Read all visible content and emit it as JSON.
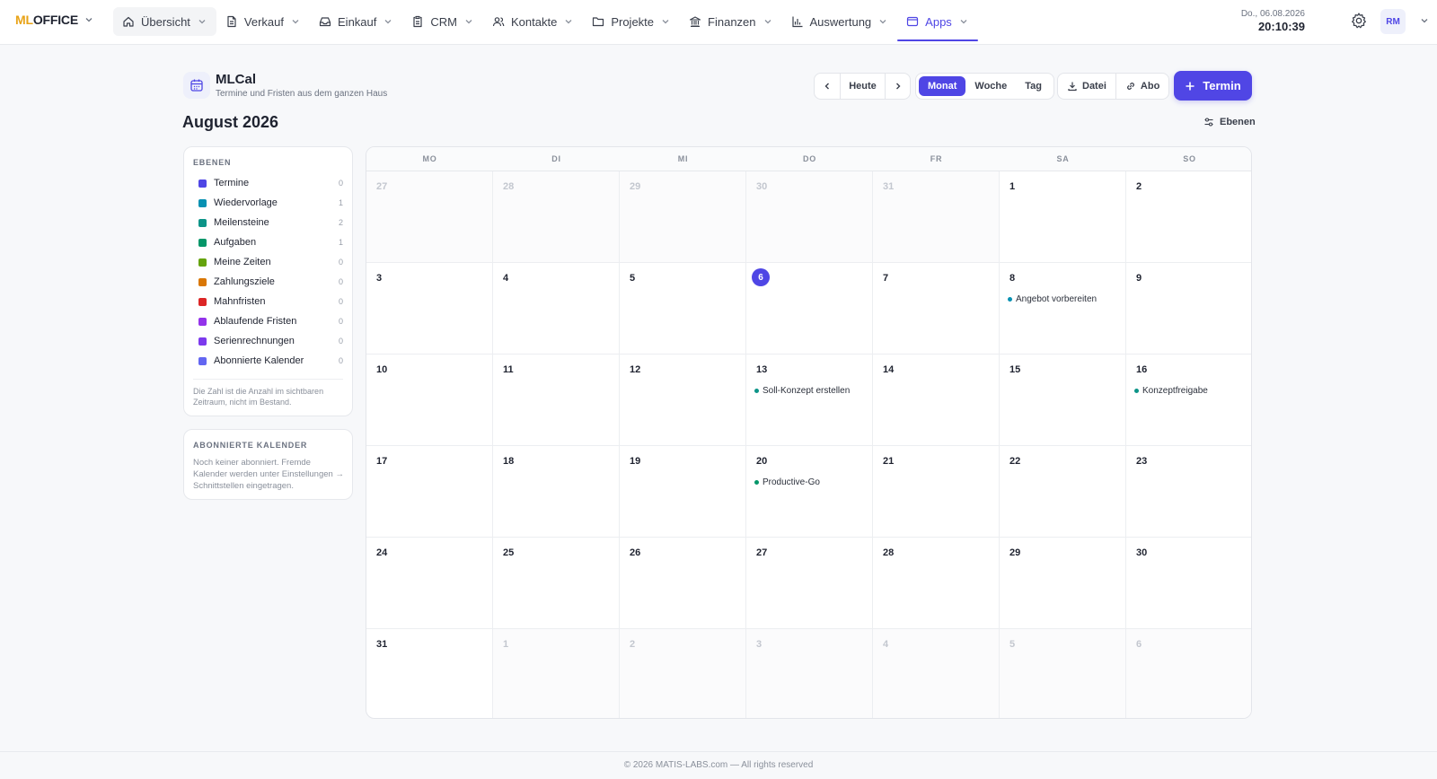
{
  "brand": {
    "ml": "ML",
    "office": "OFFICE"
  },
  "nav": [
    {
      "label": "Übersicht",
      "icon": "home-icon"
    },
    {
      "label": "Verkauf",
      "icon": "document-icon"
    },
    {
      "label": "Einkauf",
      "icon": "inbox-icon"
    },
    {
      "label": "CRM",
      "icon": "clipboard-icon"
    },
    {
      "label": "Kontakte",
      "icon": "users-icon"
    },
    {
      "label": "Projekte",
      "icon": "folder-icon"
    },
    {
      "label": "Finanzen",
      "icon": "bank-icon"
    },
    {
      "label": "Auswertung",
      "icon": "bar-chart-icon"
    },
    {
      "label": "Apps",
      "icon": "app-window-icon"
    }
  ],
  "header": {
    "date": "Do., 06.08.2026",
    "time": "20:10:39",
    "avatar": "RM"
  },
  "app": {
    "title": "MLCal",
    "subtitle": "Termine und Fristen aus dem ganzen Haus"
  },
  "toolbar": {
    "today": "Heute",
    "views": [
      "Monat",
      "Woche",
      "Tag"
    ],
    "active_view": "Monat",
    "file": "Datei",
    "abo": "Abo",
    "new": "Termin",
    "layers_toggle": "Ebenen"
  },
  "month_title": "August 2026",
  "layers": {
    "heading": "EBENEN",
    "items": [
      {
        "label": "Termine",
        "count": "0",
        "color": "#4f46e5"
      },
      {
        "label": "Wiedervorlage",
        "count": "1",
        "color": "#0891b2"
      },
      {
        "label": "Meilensteine",
        "count": "2",
        "color": "#0d9488"
      },
      {
        "label": "Aufgaben",
        "count": "1",
        "color": "#059669"
      },
      {
        "label": "Meine Zeiten",
        "count": "0",
        "color": "#65a30d"
      },
      {
        "label": "Zahlungsziele",
        "count": "0",
        "color": "#d97706"
      },
      {
        "label": "Mahnfristen",
        "count": "0",
        "color": "#dc2626"
      },
      {
        "label": "Ablaufende Fristen",
        "count": "0",
        "color": "#9333ea"
      },
      {
        "label": "Serienrechnungen",
        "count": "0",
        "color": "#7c3aed"
      },
      {
        "label": "Abonnierte Kalender",
        "count": "0",
        "color": "#6366f1"
      }
    ],
    "note": "Die Zahl ist die Anzahl im sichtbaren Zeitraum, nicht im Bestand."
  },
  "subscribed": {
    "heading": "ABONNIERTE KALENDER",
    "text": "Noch keiner abonniert. Fremde Kalender werden unter Einstellungen → Schnittstellen eingetragen."
  },
  "weekdays": [
    "MO",
    "DI",
    "MI",
    "DO",
    "FR",
    "SA",
    "SO"
  ],
  "weeks": [
    [
      {
        "d": "27",
        "m": true
      },
      {
        "d": "28",
        "m": true
      },
      {
        "d": "29",
        "m": true
      },
      {
        "d": "30",
        "m": true
      },
      {
        "d": "31",
        "m": true
      },
      {
        "d": "1"
      },
      {
        "d": "2"
      }
    ],
    [
      {
        "d": "3"
      },
      {
        "d": "4"
      },
      {
        "d": "5"
      },
      {
        "d": "6",
        "today": true
      },
      {
        "d": "7"
      },
      {
        "d": "8",
        "event": "Angebot vorbereiten",
        "color": "#0891b2"
      },
      {
        "d": "9"
      }
    ],
    [
      {
        "d": "10"
      },
      {
        "d": "11"
      },
      {
        "d": "12"
      },
      {
        "d": "13",
        "event": "Soll-Konzept erstellen",
        "color": "#0d9488"
      },
      {
        "d": "14"
      },
      {
        "d": "15"
      },
      {
        "d": "16",
        "event": "Konzeptfreigabe",
        "color": "#0d9488"
      }
    ],
    [
      {
        "d": "17"
      },
      {
        "d": "18"
      },
      {
        "d": "19"
      },
      {
        "d": "20",
        "event": "Productive-Go",
        "color": "#059669"
      },
      {
        "d": "21"
      },
      {
        "d": "22"
      },
      {
        "d": "23"
      }
    ],
    [
      {
        "d": "24"
      },
      {
        "d": "25"
      },
      {
        "d": "26"
      },
      {
        "d": "27"
      },
      {
        "d": "28"
      },
      {
        "d": "29"
      },
      {
        "d": "30"
      }
    ],
    [
      {
        "d": "31"
      },
      {
        "d": "1",
        "m": true
      },
      {
        "d": "2",
        "m": true
      },
      {
        "d": "3",
        "m": true
      },
      {
        "d": "4",
        "m": true
      },
      {
        "d": "5",
        "m": true
      },
      {
        "d": "6",
        "m": true
      }
    ]
  ],
  "footer": "© 2026 MATIS-LABS.com — All rights reserved"
}
